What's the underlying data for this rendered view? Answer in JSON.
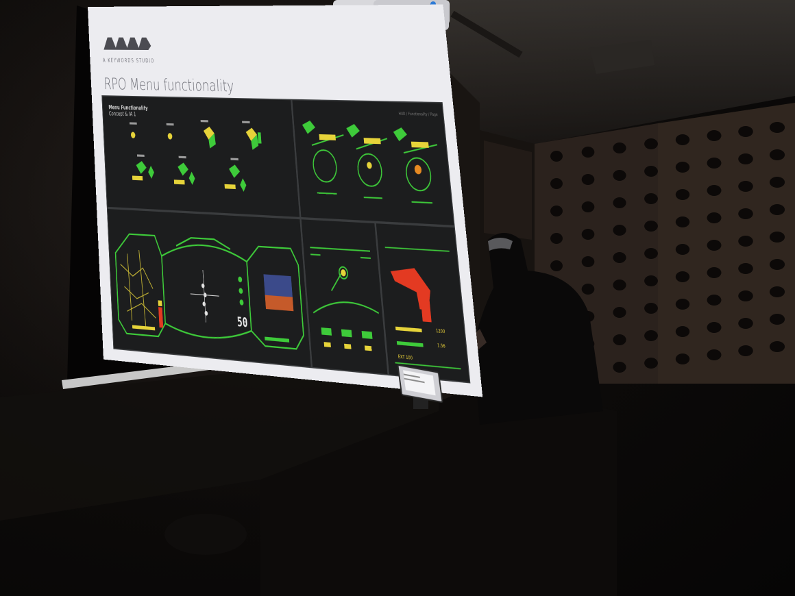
{
  "slide": {
    "studio_label": "A KEYWORDS STUDIO",
    "title": "RPO Menu functionality",
    "panel_heading": "Menu Functionality",
    "panel_subheading": "Concept & IA 1",
    "breadcrumbs": [
      "HUD",
      "/",
      "Functionality",
      "/",
      "Page"
    ],
    "speed_value": "50",
    "hud_readouts": [
      "1200",
      "1.56",
      "EXT 100"
    ]
  },
  "colors": {
    "hud_green": "#3ecb3a",
    "hud_yellow": "#e6d33a",
    "hud_red": "#e33a22",
    "slide_background": "#ececf0",
    "panel_background": "#1c1d1e"
  },
  "icons": [
    "studio-logo-icon",
    "projector-icon",
    "tablet-icon"
  ]
}
